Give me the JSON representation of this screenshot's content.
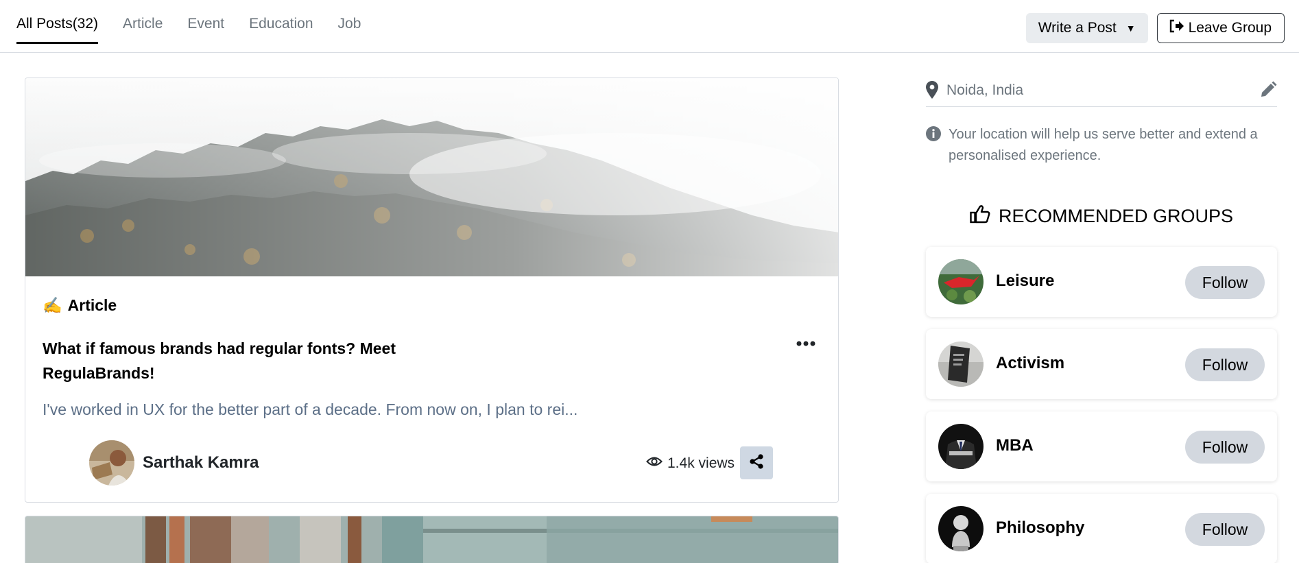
{
  "tabs": [
    {
      "label": "All Posts(32)",
      "active": true
    },
    {
      "label": "Article",
      "active": false
    },
    {
      "label": "Event",
      "active": false
    },
    {
      "label": "Education",
      "active": false
    },
    {
      "label": "Job",
      "active": false
    }
  ],
  "actions": {
    "write_post_label": "Write a Post",
    "write_post_caret": "▼",
    "leave_group_label": "Leave Group"
  },
  "post": {
    "type_emoji": "✍️",
    "type_label": "Article",
    "title": "What if famous brands had regular fonts? Meet RegulaBrands!",
    "excerpt": "I've worked in UX for the better part of a decade. From now on, I plan to rei...",
    "author_name": "Sarthak Kamra",
    "views": "1.4k views"
  },
  "sidebar": {
    "location_value": "Noida, India",
    "location_info": "Your location will help us serve better and extend a personalised experience.",
    "recommended_heading": "RECOMMENDED GROUPS",
    "groups": [
      {
        "name": "Leisure",
        "follow_label": "Follow"
      },
      {
        "name": "Activism",
        "follow_label": "Follow"
      },
      {
        "name": "MBA",
        "follow_label": "Follow"
      },
      {
        "name": "Philosophy",
        "follow_label": "Follow"
      }
    ]
  },
  "colors": {
    "accent_text": "#000000",
    "muted_text": "#6c757d",
    "excerpt_text": "#5c6f87",
    "share_bg": "#cfd8e3",
    "follow_bg": "#d3d8df",
    "border": "#d9dde3"
  },
  "icons": [
    "location-pin-icon",
    "pencil-icon",
    "info-icon",
    "thumbs-up-icon",
    "eye-icon",
    "share-icon",
    "more-dots-icon",
    "leave-icon"
  ]
}
